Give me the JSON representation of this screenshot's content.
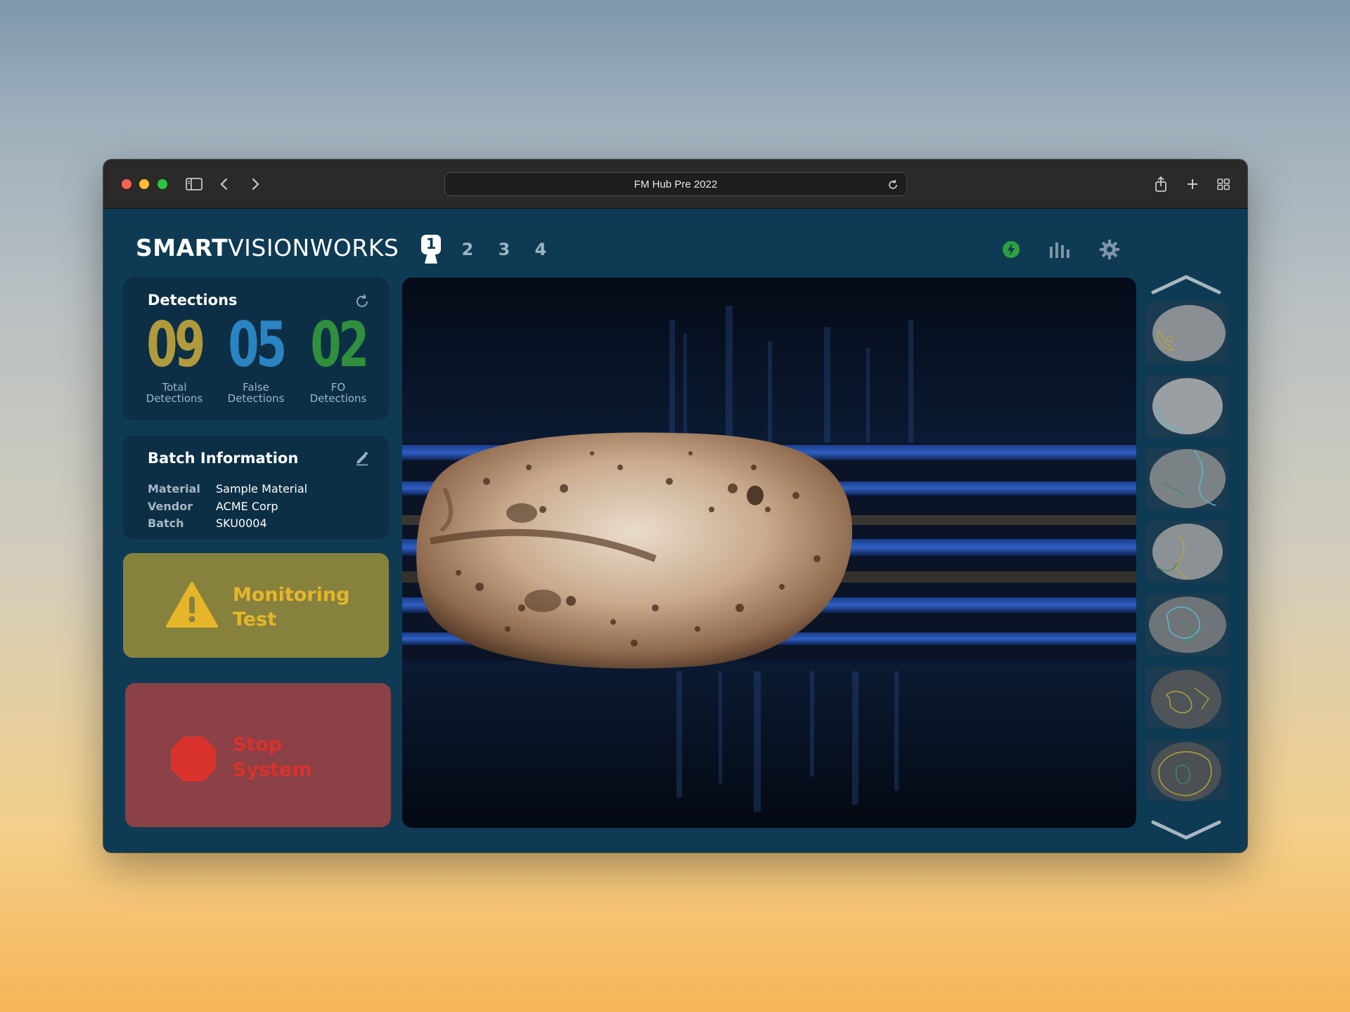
{
  "browser": {
    "address_text": "FM Hub Pre 2022"
  },
  "header": {
    "logo_bold": "SMART",
    "logo_rest": "VISIONWORKS",
    "cameras": [
      "1",
      "2",
      "3",
      "4"
    ],
    "active_camera": "1",
    "icons": [
      "power-status-icon",
      "bar-chart-icon",
      "gear-icon"
    ],
    "status_color": "#2ea043"
  },
  "detections": {
    "title": "Detections",
    "total_value": "09",
    "total_label_1": "Total",
    "total_label_2": "Detections",
    "false_value": "05",
    "false_label_1": "False",
    "false_label_2": "Detections",
    "fo_value": "02",
    "fo_label_1": "FO",
    "fo_label_2": "Detections",
    "colors": {
      "total": "#b09a3c",
      "false": "#2b84c2",
      "fo": "#2f8f3d"
    }
  },
  "batch": {
    "title": "Batch Information",
    "material_key": "Material",
    "material_value": "Sample Material",
    "vendor_key": "Vendor",
    "vendor_value": "ACME Corp",
    "batch_key": "Batch",
    "batch_value": "SKU0004"
  },
  "monitoring": {
    "line1": "Monitoring",
    "line2": "Test",
    "icon": "warning-icon"
  },
  "stop": {
    "line1": "Stop",
    "line2": "System",
    "icon": "stop-sign-icon"
  },
  "viewer": {
    "subject": "potato on conveyor"
  },
  "carousel": {
    "thumbnail_count": 7,
    "up_icon": "chevron-up-icon",
    "down_icon": "chevron-down-icon"
  }
}
